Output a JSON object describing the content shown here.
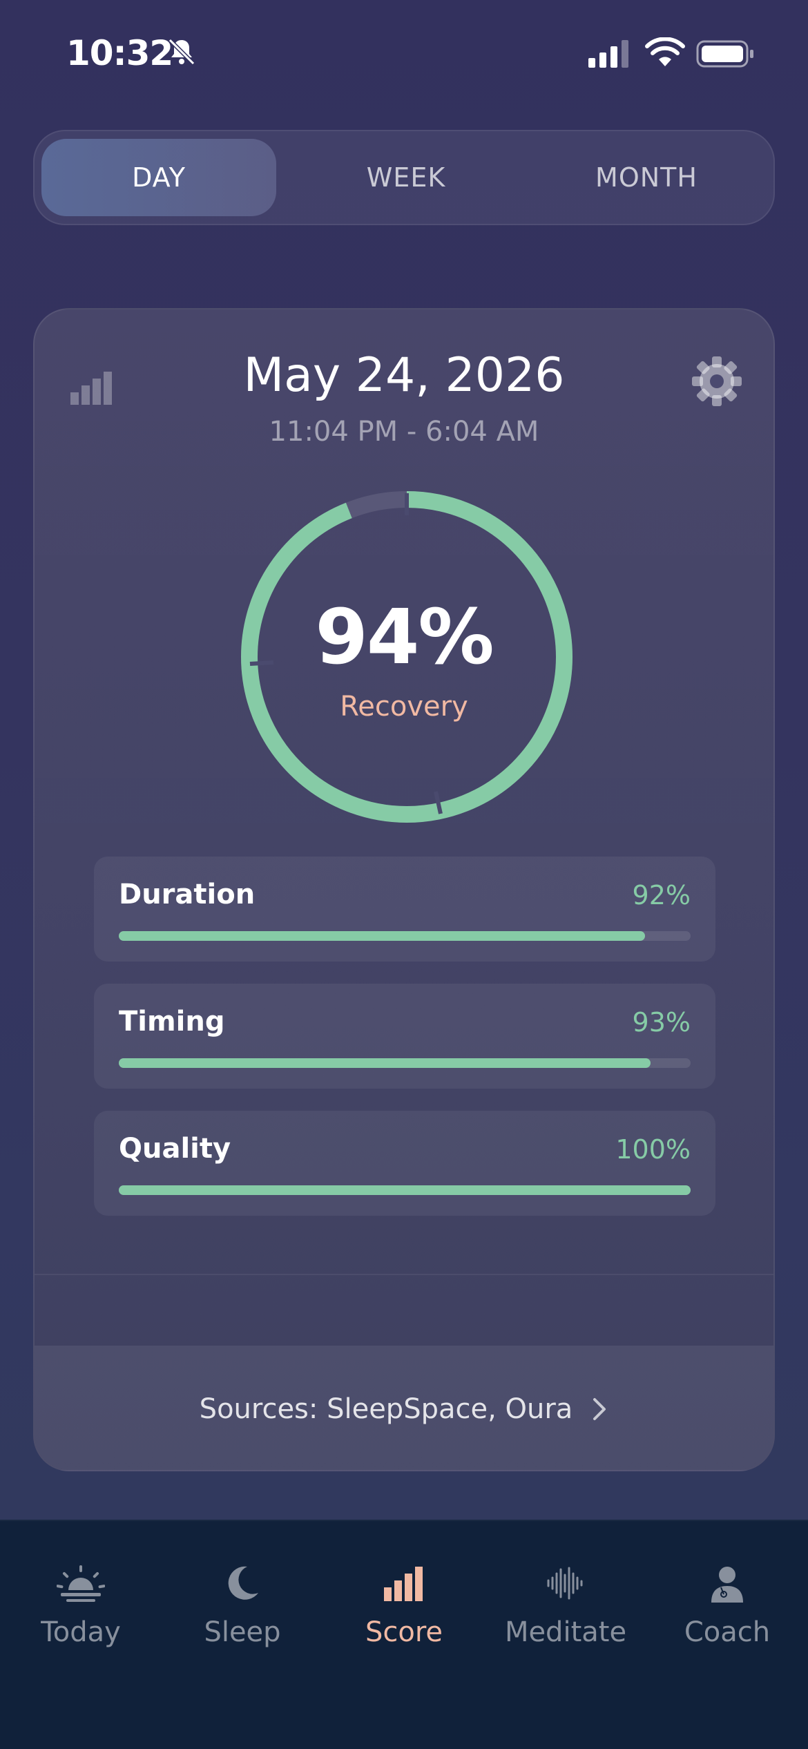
{
  "status_bar": {
    "time": "10:32",
    "bell_icon": "bell-slash-icon",
    "signal_icon": "cellular-signal-icon",
    "wifi_icon": "wifi-icon",
    "battery_icon": "battery-icon"
  },
  "segmented": {
    "items": [
      {
        "label": "DAY",
        "active": true
      },
      {
        "label": "WEEK",
        "active": false
      },
      {
        "label": "MONTH",
        "active": false
      }
    ]
  },
  "card": {
    "date": "May 24, 2026",
    "time_range": "11:04 PM - 6:04 AM",
    "left_icon": "bar-chart-icon",
    "right_icon": "gear-icon",
    "score": {
      "value": "94%",
      "label": "Recovery",
      "fraction": 0.94
    },
    "metrics": [
      {
        "name": "Duration",
        "value": "92%",
        "fraction": 0.92
      },
      {
        "name": "Timing",
        "value": "93%",
        "fraction": 0.93
      },
      {
        "name": "Quality",
        "value": "100%",
        "fraction": 1.0
      }
    ],
    "sources": "Sources: SleepSpace, Oura"
  },
  "tab_bar": {
    "items": [
      {
        "label": "Today",
        "icon": "sunrise-icon",
        "active": false
      },
      {
        "label": "Sleep",
        "icon": "moon-icon",
        "active": false
      },
      {
        "label": "Score",
        "icon": "bar-chart-icon",
        "active": true
      },
      {
        "label": "Meditate",
        "icon": "sound-wave-icon",
        "active": false
      },
      {
        "label": "Coach",
        "icon": "coach-person-icon",
        "active": false
      }
    ]
  },
  "colors": {
    "accent_green": "#86cba6",
    "accent_peach": "#f1b9a3",
    "tab_bar_bg": "#10213a"
  }
}
